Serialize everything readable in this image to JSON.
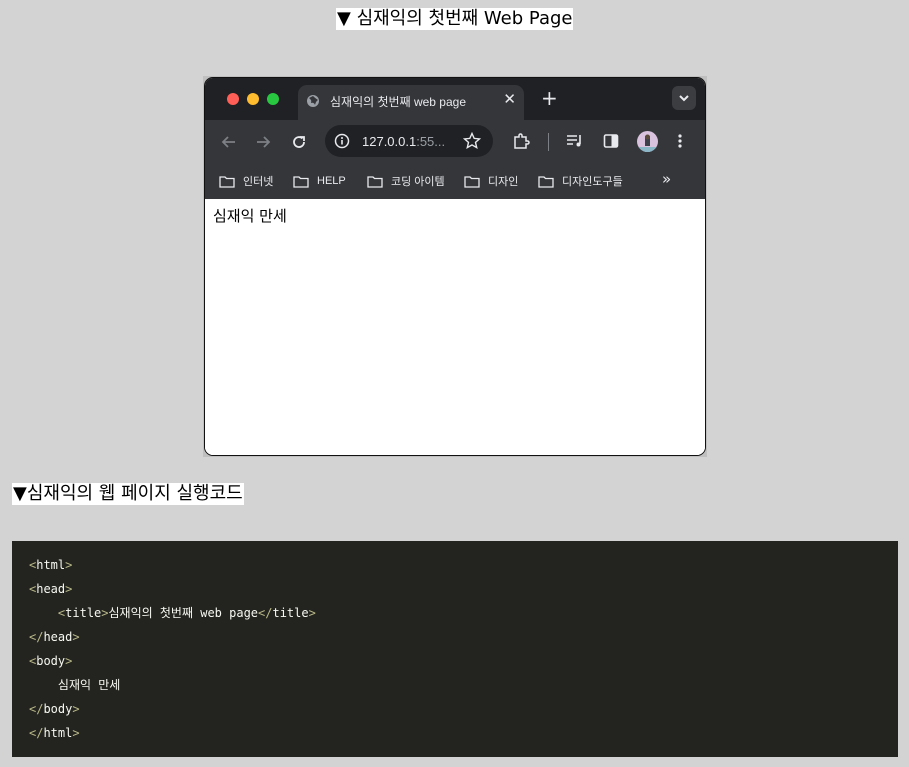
{
  "captions": {
    "top": "▼ 심재익의 첫번째 Web Page",
    "code": "▼심재익의 웹 페이지 실행코드"
  },
  "browser": {
    "tab_title": "심재익의 첫번째 web page",
    "url_host": "127.0.0.1",
    "url_port_truncated": ":55...",
    "bookmarks": [
      "인터넷",
      "HELP",
      "코딩 아이템",
      "디자인",
      "디자인도구들"
    ],
    "page_text": "심재익 만세",
    "window_controls": {
      "close": "#ff5f57",
      "minimize": "#febc2e",
      "maximize": "#28c840"
    }
  },
  "code": {
    "lines": [
      {
        "indent": "",
        "parts": [
          [
            "br",
            "<"
          ],
          [
            "tg",
            "html"
          ],
          [
            "br",
            ">"
          ]
        ]
      },
      {
        "indent": "",
        "parts": [
          [
            "br",
            "<"
          ],
          [
            "tg",
            "head"
          ],
          [
            "br",
            ">"
          ]
        ]
      },
      {
        "indent": "    ",
        "parts": [
          [
            "br",
            "<"
          ],
          [
            "tg",
            "title"
          ],
          [
            "br",
            ">"
          ],
          [
            "tx",
            "심재익의 첫번째 web page"
          ],
          [
            "br",
            "</"
          ],
          [
            "tg",
            "title"
          ],
          [
            "br",
            ">"
          ]
        ]
      },
      {
        "indent": "",
        "parts": [
          [
            "br",
            "</"
          ],
          [
            "tg",
            "head"
          ],
          [
            "br",
            ">"
          ]
        ]
      },
      {
        "indent": "",
        "parts": [
          [
            "br",
            "<"
          ],
          [
            "tg",
            "body"
          ],
          [
            "br",
            ">"
          ]
        ]
      },
      {
        "indent": "    ",
        "parts": [
          [
            "tx",
            "심재익 만세"
          ]
        ]
      },
      {
        "indent": "",
        "parts": [
          [
            "br",
            "</"
          ],
          [
            "tg",
            "body"
          ],
          [
            "br",
            ">"
          ]
        ]
      },
      {
        "indent": "",
        "parts": [
          [
            "br",
            "</"
          ],
          [
            "tg",
            "html"
          ],
          [
            "br",
            ">"
          ]
        ]
      }
    ]
  }
}
